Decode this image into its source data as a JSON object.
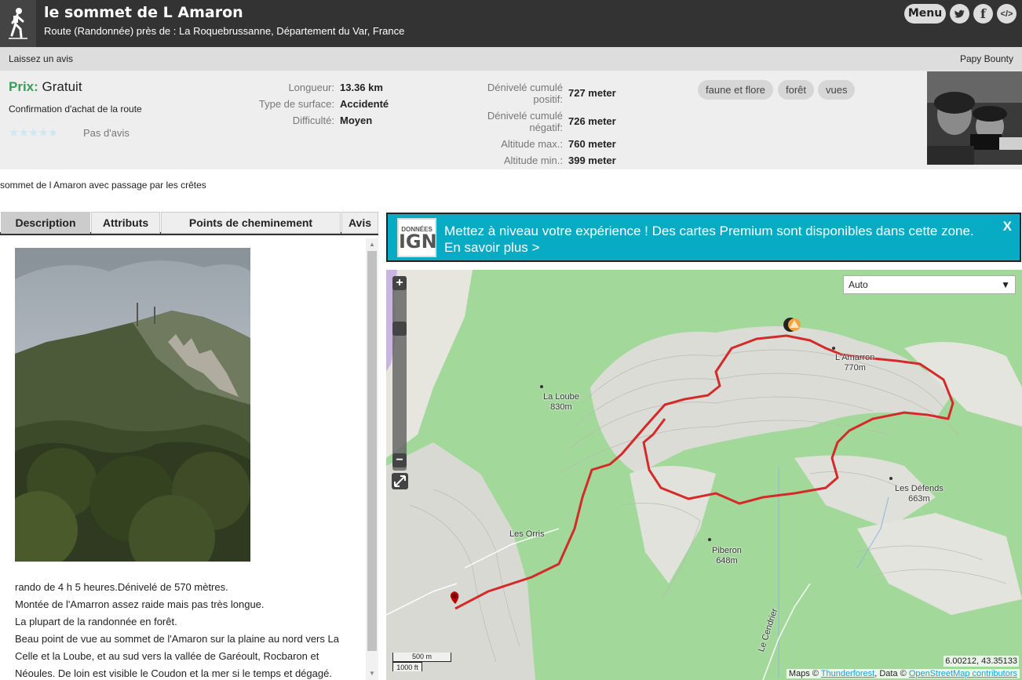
{
  "header": {
    "title": "le sommet de L Amaron",
    "subtitle": "Route (Randonnée) près de : La Roquebrussanne, Département du Var, France",
    "menu_label": "Menu",
    "embed_label": "</>"
  },
  "review_bar": {
    "leave_review": "Laissez un avis",
    "author": "Papy Bounty"
  },
  "summary": {
    "price_label": "Prix:",
    "price_value": "Gratuit",
    "purchase_confirmation": "Confirmation d'achat de la route",
    "rating_stars": "★★★★★",
    "rating_text": "Pas d'avis",
    "length_label": "Longueur:",
    "length_value": "13.36 km",
    "surface_label": "Type de surface:",
    "surface_value": "Accidenté",
    "difficulty_label": "Difficulté:",
    "difficulty_value": "Moyen",
    "ascent_label_1": "Dénivelé cumulé",
    "ascent_label_2": "positif:",
    "ascent_value": "727 meter",
    "descent_label_1": "Dénivelé cumulé",
    "descent_label_2": "négatif:",
    "descent_value": "726 meter",
    "alt_max_label": "Altitude max.:",
    "alt_max_value": "760 meter",
    "alt_min_label": "Altitude min.:",
    "alt_min_value": "399 meter",
    "tags": [
      "faune et flore",
      "forêt",
      "vues"
    ]
  },
  "tagline": "sommet de l Amaron avec passage par les crêtes",
  "tabs": [
    "Description",
    "Attributs",
    "Points de cheminement",
    "Avis"
  ],
  "description": {
    "lines": [
      "rando de 4 h 5 heures.Dénivelé de 570 mètres.",
      "Montée de l'Amarron assez raide mais pas très longue.",
      "La plupart de la randonnée en forêt.",
      "Beau point de vue au sommet de l'Amaron sur la plaine au nord vers La Celle et la Loube, et au sud vers la vallée de Garéoult, Rocbaron et Néoules. De loin est visible le Coudon et la mer si le temps et dégagé."
    ]
  },
  "ign_banner": {
    "logo_small": "DONNÉES",
    "logo_big": "IGN",
    "text": "Mettez à niveau votre expérience ! Des cartes Premium sont disponibles dans cette zone. En savoir plus >",
    "close": "X"
  },
  "map": {
    "layer_select": "Auto",
    "zoom_in": "+",
    "zoom_out": "−",
    "coordinates": "6.00212, 43.35133",
    "scale_metric": "500 m",
    "scale_imperial": "1000 ft",
    "attribution_prefix": "Maps ©",
    "attribution_tf": "Thunderforest",
    "attribution_mid": ", Data ©",
    "attribution_osm": "OpenStreetMap contributors",
    "places": [
      {
        "name": "L'Amarron",
        "elev": "770m"
      },
      {
        "name": "La Loube",
        "elev": "830m"
      },
      {
        "name": "Les Défends",
        "elev": "663m"
      },
      {
        "name": "Les Orris",
        "elev": ""
      },
      {
        "name": "Piberon",
        "elev": "648m"
      }
    ],
    "road_label": "Le Cendrier",
    "colors": {
      "route": "#d42a2a",
      "forest": "#a3d89b",
      "relief": "#d9d9d4"
    }
  }
}
